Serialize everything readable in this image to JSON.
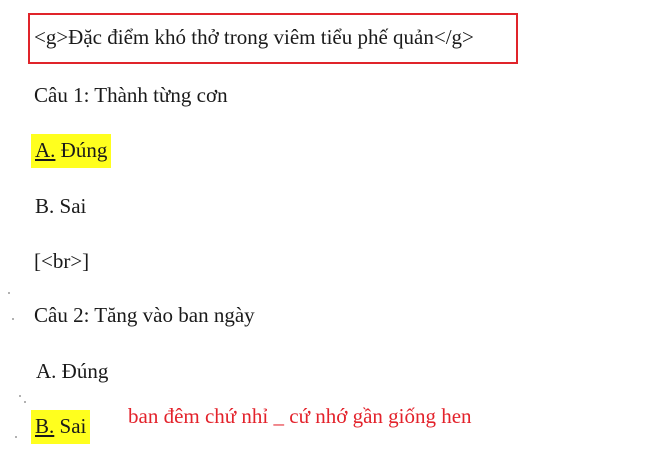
{
  "title": {
    "text": "<g>Đặc điểm khó thở trong viêm tiểu phế quản</g>",
    "box_color": "#e0242a"
  },
  "questions": [
    {
      "prompt": "Câu 1: Thành từng cơn",
      "options": [
        {
          "letter": "A.",
          "text": "Đúng",
          "selected": true
        },
        {
          "letter": "B.",
          "text": "Sai",
          "selected": false
        }
      ]
    },
    {
      "prompt": "Câu 2: Tăng vào ban ngày",
      "options": [
        {
          "letter": "A.",
          "text": "Đúng",
          "selected": false
        },
        {
          "letter": "B.",
          "text": "Sai",
          "selected": true
        }
      ]
    }
  ],
  "separator": "[<br>]",
  "note": {
    "text": "ban đêm chứ nhỉ _ cứ nhớ gần giống hen",
    "color": "#e3222b"
  },
  "highlight_color": "#ffff1e"
}
